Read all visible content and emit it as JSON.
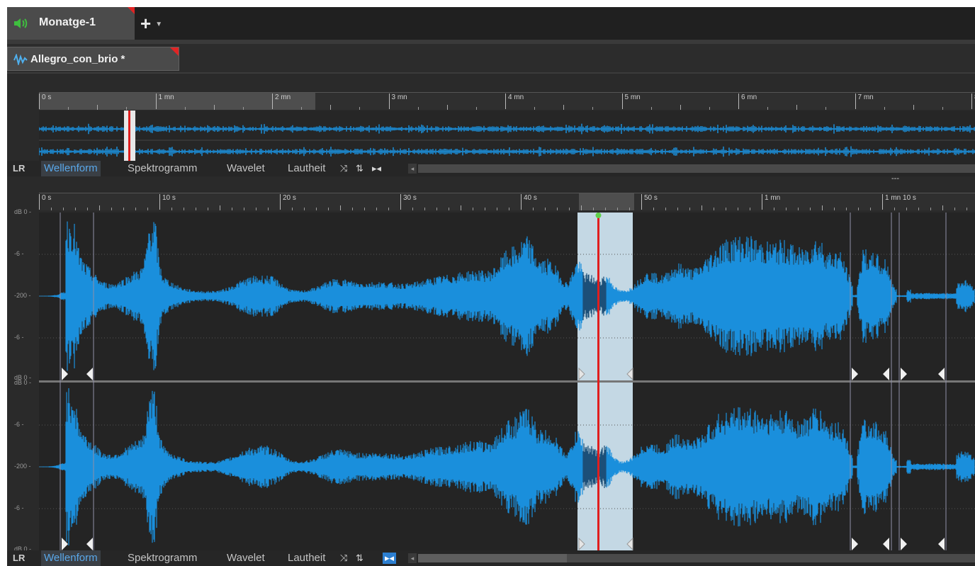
{
  "tabs": {
    "main_label": "Monatge-1",
    "add_label": "+"
  },
  "file_tab": {
    "label": "Allegro_con_brio *"
  },
  "overview": {
    "ruler_labels": [
      "0 s",
      "1 mn",
      "2 mn",
      "3 mn",
      "4 mn",
      "5 mn",
      "6 mn",
      "7 mn",
      "8"
    ]
  },
  "toolbar_top": {
    "lr": "LR",
    "items": [
      "Wellenform",
      "Spektrogramm",
      "Wavelet",
      "Lautheit"
    ],
    "active": "Wellenform"
  },
  "toolbar_bottom": {
    "lr": "LR",
    "items": [
      "Wellenform",
      "Spektrogramm",
      "Wavelet",
      "Lautheit"
    ],
    "active": "Wellenform"
  },
  "extra_label": "---",
  "main": {
    "ruler_labels": [
      "0 s",
      "10 s",
      "20 s",
      "30 s",
      "40 s",
      "50 s",
      "1 mn",
      "1 mn 10 s"
    ],
    "db_labels_track1": [
      "dB 0 -",
      "-6 -",
      "-200 -",
      "-6 -",
      "dB 0 -"
    ],
    "db_labels_track2": [
      "dB 0 -",
      "-6 -",
      "-200 -",
      "-6 -",
      "dB 0 -"
    ]
  },
  "colors": {
    "waveform": "#1a8fdc",
    "waveform_selected": "#1c4f78",
    "selection": "#c4d8e4",
    "cursor": "#e01e1e",
    "background": "#242424"
  }
}
